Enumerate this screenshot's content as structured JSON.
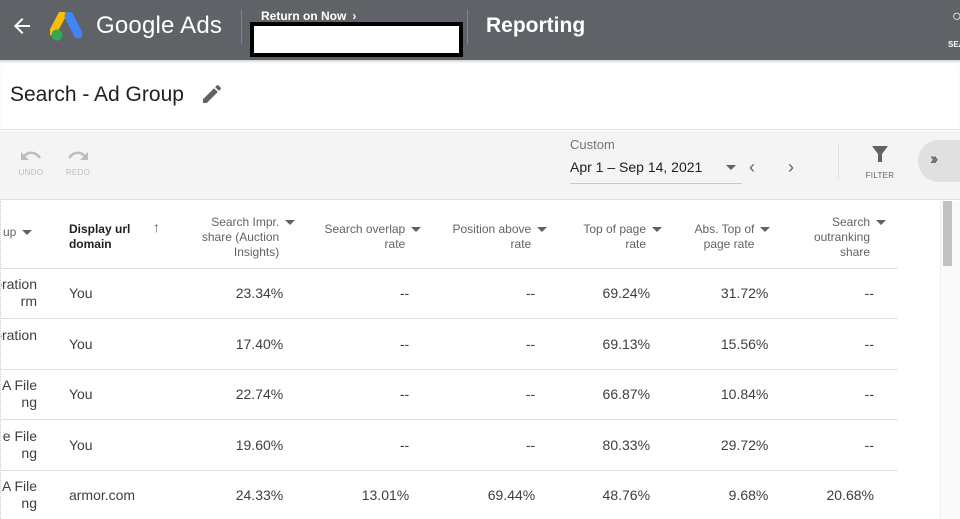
{
  "header": {
    "product_name": "Google Ads",
    "account_breadcrumb": "Return on Now",
    "section_title": "Reporting",
    "search_label": "SEARCH",
    "colors": {
      "bar": "#5f6368",
      "logo_blue": "#4285f4",
      "logo_yellow": "#fbbc04",
      "logo_green": "#34a853"
    }
  },
  "page": {
    "title": "Search - Ad Group"
  },
  "toolbar": {
    "undo_label": "UNDO",
    "redo_label": "REDO",
    "date_range_type": "Custom",
    "date_range_value": "Apr 1 – Sep 14, 2021",
    "filter_label": "FILTER"
  },
  "table": {
    "columns": [
      {
        "label": "Ad group",
        "visible_label": "up"
      },
      {
        "label": "Display url domain",
        "sorted": "ascending"
      },
      {
        "label": "Search Impr. share (Auction Insights)"
      },
      {
        "label": "Search overlap rate"
      },
      {
        "label": "Position above rate"
      },
      {
        "label": "Top of page rate"
      },
      {
        "label": "Abs. Top of page rate"
      },
      {
        "label": "Search outranking share"
      }
    ],
    "rows": [
      {
        "ad_group": [
          "poration",
          "rm"
        ],
        "domain": "You",
        "impr_share": "23.34%",
        "overlap": "--",
        "position_above": "--",
        "top_page": "69.24%",
        "abs_top": "31.72%",
        "outranking": "--"
      },
      {
        "ad_group": [
          "poration",
          ""
        ],
        "domain": "You",
        "impr_share": "17.40%",
        "overlap": "--",
        "position_above": "--",
        "top_page": "69.13%",
        "abs_top": "15.56%",
        "outranking": "--"
      },
      {
        "ad_group": [
          "A File",
          "ng"
        ],
        "domain": "You",
        "impr_share": "22.74%",
        "overlap": "--",
        "position_above": "--",
        "top_page": "66.87%",
        "abs_top": "10.84%",
        "outranking": "--"
      },
      {
        "ad_group": [
          "e File",
          "ng"
        ],
        "domain": "You",
        "impr_share": "19.60%",
        "overlap": "--",
        "position_above": "--",
        "top_page": "80.33%",
        "abs_top": "29.72%",
        "outranking": "--"
      },
      {
        "ad_group": [
          "A File",
          "ng"
        ],
        "domain": "armor.com",
        "impr_share": "24.33%",
        "overlap": "13.01%",
        "position_above": "69.44%",
        "top_page": "48.76%",
        "abs_top": "9.68%",
        "outranking": "20.68%"
      }
    ]
  }
}
